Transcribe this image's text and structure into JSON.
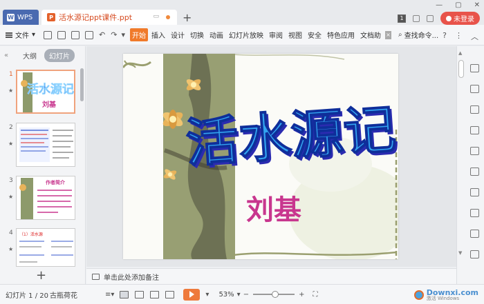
{
  "titlebar": {
    "app_tab": "WPS",
    "doc_tab": "活水源记ppt课件.ppt",
    "login_label": "未登录",
    "badge": "1"
  },
  "ribbon": {
    "file_label": "文件",
    "tabs": [
      "开始",
      "插入",
      "设计",
      "切换",
      "动画",
      "幻灯片放映",
      "审阅",
      "视图",
      "安全",
      "特色应用",
      "文档助"
    ],
    "active_tab": "开始",
    "search_label": "查找命令..."
  },
  "left_panel": {
    "outline_tab": "大纲",
    "slides_tab": "幻灯片",
    "thumbnails": [
      {
        "num": "1",
        "title": "活水源记",
        "subtitle": "刘基"
      },
      {
        "num": "2"
      },
      {
        "num": "3",
        "text": "作者简介"
      },
      {
        "num": "4",
        "text": "（1）活水源"
      }
    ]
  },
  "slide": {
    "title": "活水源记",
    "author": "刘基"
  },
  "notes": {
    "placeholder": "单击此处添加备注"
  },
  "status": {
    "slide_counter": "幻灯片 1 / 20",
    "theme": "古瓶荷花",
    "zoom": "53%",
    "zoom_fraction": 0.53,
    "watermark": "Downxi.com",
    "watermark_small": "激活 Windows"
  }
}
